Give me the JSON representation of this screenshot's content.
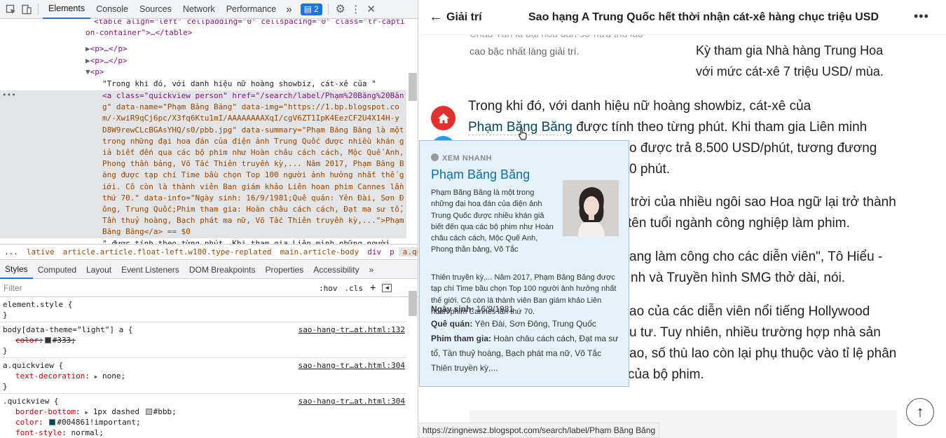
{
  "devtools": {
    "tabs": [
      "Elements",
      "Console",
      "Sources",
      "Network",
      "Performance"
    ],
    "more_tabs": "»",
    "issues_count": "2",
    "elements_lines": {
      "l1": "<table align=\"left\" cellpadding=\"0\" cellspacing=\"0\" class=\"tr-capti",
      "l2": "on-container\">…</table>",
      "l3": "<p>…</p>",
      "l4": "<p>…</p>",
      "l5": "<p>",
      "l6": "\"Trong khi đó, với danh hiệu nữ hoàng showbiz, cát-xê của \"",
      "sel": [
        "<a class=\"quickview person\" href=\"/search/label/Phạm%20Băng%20Băn",
        "g\" data-name=\"Phạm Băng Băng\" data-img=\"https://1.bp.blogspot.co",
        "m/-XwiR9qCj6pc/X3fq6Ktu1mI/AAAAAAAAXqI/cgV6ZT1IpK4EezCF2U4X14H-y",
        "D8W9rewCLcBGAsYHQ/s0/pbb.jpg\" data-summary=\"Phạm Băng Băng là một",
        "trong những đại hoa đán của điện ảnh Trung Quốc được nhiều khán g",
        "iả biết đến qua các bộ phim như Hoàn châu cách cách, Mộc Quế Anh,",
        "Phong thần bảng, Võ Tắc Thiên truyền kỳ,... Năm 2017, Phạm Băng B",
        "ăng được tạp chí Time bầu chọn Top 100 người ảnh hưởng nhất thế g",
        "iới. Cô còn là thành viên Ban giám khảo Liên hoan phim Cannes lần",
        "thứ 70.\" data-info=\"Ngày sinh: 16/9/1981;Quê quán: Yên Đài, Sơn Đ",
        "ông, Trung Quốc;Phim tham gia: Hoàn châu cách cách, Đạt ma sư tổ,",
        "Tần thuỷ hoàng, Bạch phát ma nữ, Võ Tắc Thiên truyền kỳ,...\">Phạm",
        "Băng Băng</a> == $0"
      ],
      "last": "\" được tính theo từng phút. Khi tham gia Liên minh những người"
    },
    "breadcrumbs": [
      "...",
      "lative",
      "article.article.float-left.w100.type-replated",
      "main.article-body",
      "div",
      "p",
      "a.quickview.person"
    ],
    "subtabs": [
      "Styles",
      "Computed",
      "Layout",
      "Event Listeners",
      "DOM Breakpoints",
      "Properties",
      "Accessibility"
    ],
    "filter_placeholder": "Filter",
    "hov": ":hov",
    "cls": ".cls",
    "styles": {
      "r1_sel": "element.style {",
      "r2_sel": "body[data-theme=\"light\"] a {",
      "r2_src": "sao-hang-tr…at.html:132",
      "r2_prop": "color",
      "r2_val": "#333;",
      "r3_sel": "a.quickview {",
      "r3_src": "sao-hang-tr…at.html:304",
      "r3_prop": "text-decoration",
      "r3_val": "none;",
      "r4_sel": ".quickview {",
      "r4_src": "sao-hang-tr…at.html:304",
      "r4_p1": "border-bottom",
      "r4_v1": "1px dashed",
      "r4_v1b": "#bbb;",
      "r4_p2": "color",
      "r4_v2": "#004861!important;",
      "r4_p3": "font-style",
      "r4_v3": "normal;",
      "close": "}"
    }
  },
  "page": {
    "category": "Giải trí",
    "title": "Sao hạng A Trung Quốc hết thời nhận cát-xê hàng chục triệu USD",
    "caption": [
      "Châu Tấn là đại hoa đán sở hữu thù lao",
      "cao bậc nhất làng giải trí."
    ],
    "sidebox": [
      "Kỳ tham gia Nhà hàng Trung Hoa",
      "với mức cát-xê 7 triệu USD/ mùa."
    ],
    "para1_a": "Trong khi đó, với danh hiệu nữ hoàng showbiz, cát-xê của",
    "para1_link": "Phạm Băng Băng",
    "para1_b": " được tính theo từng phút. Khi tham gia Liên minh",
    "para1_c": "o được trả 8.500 USD/phút, tương đương",
    "para1_d": "0 phút.",
    "para2_a": "trời của nhiều ngôi sao Hoa ngữ lại trở thành",
    "para2_b": " tên tuổi ngành công nghiệp làm phim.",
    "para3_a": "ang làm công cho các diễn viên\", Tô Hiểu -",
    "para3_b": "nh và Truyền hình SMG thở dài, nói.",
    "para4_a": "ao của các diễn viên nổi tiếng Hollywood",
    "para4_b": "u tư. Tuy nhiên, nhiều trường hợp nhà sản",
    "para4_c": "ao, số thù lao còn lại phụ thuộc vào tỉ lệ phân",
    "para4_d": " của bộ phim."
  },
  "quickview": {
    "label": "XEM NHANH",
    "name": "Phạm Băng Băng",
    "summary_1": "Phạm Băng Băng là một trong những đại hoa đán của điện ảnh Trung Quốc được nhiều khán giả biết đến qua các bộ phim như Hoàn châu cách cách, Mộc Quế Anh, Phong thần bảng, Võ Tắc",
    "summary_2": "Thiên truyền kỳ,... Năm 2017, Phạm Băng Băng được tạp chí Time bầu chọn Top 100 người ảnh hưởng nhất thế giới. Cô còn là thành viên Ban giám khảo Liên hoan phim Cannes lần thứ 70.",
    "birth_label": "Ngày sinh:",
    "birth": " 16/9/1981",
    "home_label": "Quê quán:",
    "home": " Yên Đài, Sơn Đông, Trung Quốc",
    "films_label": "Phim tham gia:",
    "films": " Hoàn châu cách cách, Đạt ma sư tổ, Tần thuỷ hoàng, Bạch phát ma nữ, Võ Tắc Thiên truyền kỳ,..."
  },
  "status_url": "https://zingnewsz.blogspot.com/search/label/Phạm Băng Băng",
  "colors": {
    "accent": "#1a73e8",
    "home_button": "#e03030",
    "link": "#004861",
    "popup_bg": "#e5f2fb"
  }
}
